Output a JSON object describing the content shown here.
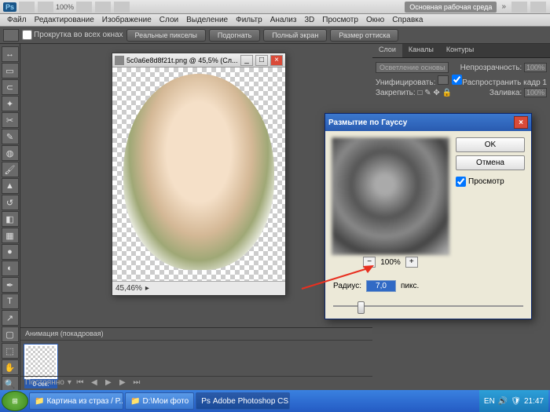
{
  "menubar": {
    "zoom_pct": "100%",
    "workspace": "Основная рабочая среда"
  },
  "menu": [
    "Файл",
    "Редактирование",
    "Изображение",
    "Слои",
    "Выделение",
    "Фильтр",
    "Анализ",
    "3D",
    "Просмотр",
    "Окно",
    "Справка"
  ],
  "optbar": {
    "scroll_all": "Прокрутка во всех окнах",
    "b1": "Реальные пикселы",
    "b2": "Подогнать",
    "b3": "Полный экран",
    "b4": "Размер оттиска"
  },
  "doc": {
    "title": "5c0a6e8d8f21t.png @ 45,5% (Сл...",
    "status_zoom": "45,46%"
  },
  "layers_panel": {
    "tabs": [
      "Слои",
      "Каналы",
      "Контуры"
    ],
    "blend": "Осветление основы",
    "opacity_label": "Непрозрачность:",
    "opacity": "100%",
    "unify": "Унифицировать:",
    "propagate": "Распространить кадр 1",
    "lock": "Закрепить:",
    "fill_label": "Заливка:",
    "fill": "100%"
  },
  "dialog": {
    "title": "Размытие по Гауссу",
    "ok": "OK",
    "cancel": "Отмена",
    "preview": "Просмотр",
    "zoom": "100%",
    "radius_label": "Радиус:",
    "radius_value": "7,0",
    "radius_unit": "пикс."
  },
  "anim": {
    "title": "Анимация (покадровая)",
    "frame_dur": "0 сек.",
    "loop": "Постоянно"
  },
  "taskbar": {
    "items": [
      "Картина из страз / Р...",
      "D:\\Мои фото",
      "Adobe Photoshop CS..."
    ],
    "lang": "EN",
    "time": "21:47"
  }
}
